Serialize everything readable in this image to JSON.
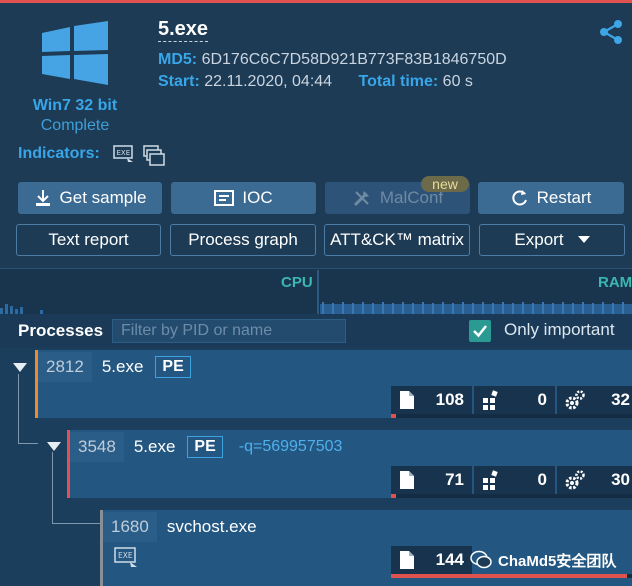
{
  "header": {
    "os_name": "Win7 32 bit",
    "os_status": "Complete",
    "indicators_label": "Indicators:",
    "file_name": "5.exe",
    "md5_label": "MD5:",
    "md5_value": "6D176C6C7D58D921B773F83B1846750D",
    "start_label": "Start:",
    "start_value": "22.11.2020, 04:44",
    "total_label": "Total time:",
    "total_value": "60 s"
  },
  "buttons": {
    "get_sample": "Get sample",
    "ioc": "IOC",
    "malconf": "MalConf",
    "malconf_badge": "new",
    "restart": "Restart",
    "text_report": "Text report",
    "process_graph": "Process graph",
    "attck_matrix": "ATT&CK™ matrix",
    "export": "Export"
  },
  "resources": {
    "cpu_label": "CPU",
    "ram_label": "RAM"
  },
  "processes": {
    "title": "Processes",
    "filter_placeholder": "Filter by PID or name",
    "only_important_label": "Only important",
    "only_important_checked": true,
    "items": [
      {
        "pid": "2812",
        "name": "5.exe",
        "badge": "PE",
        "cmd": "",
        "files": "108",
        "modules": "0",
        "settings": "32",
        "accent": "#ef8a2a",
        "activity": 0.02
      },
      {
        "pid": "3548",
        "name": "5.exe",
        "badge": "PE",
        "cmd": "-q=569957503",
        "files": "71",
        "modules": "0",
        "settings": "30",
        "accent": "#e0524d",
        "activity": 0.02
      },
      {
        "pid": "1680",
        "name": "svchost.exe",
        "badge": "",
        "cmd": "",
        "files": "144",
        "modules": "",
        "settings": "",
        "accent": "#8a8f95",
        "activity": 0.98
      }
    ]
  },
  "watermark": "ChaMd5安全团队",
  "colors": {
    "background": "#1d3b55",
    "accent_blue": "#38a6e8",
    "alert_red": "#e0524d",
    "teal": "#2b9a93"
  }
}
